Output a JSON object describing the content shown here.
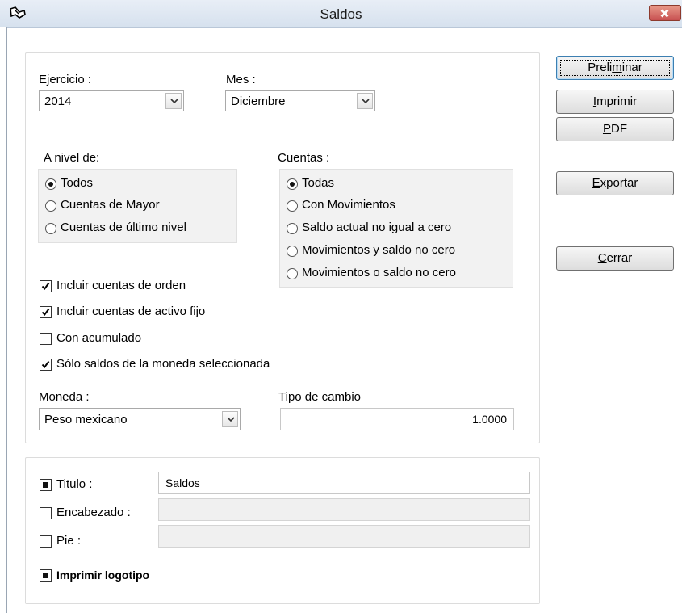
{
  "window": {
    "title": "Saldos"
  },
  "filters": {
    "ejercicio_label": "Ejercicio :",
    "ejercicio_value": "2014",
    "mes_label": "Mes :",
    "mes_value": "Diciembre"
  },
  "nivel": {
    "label": "A nivel de:",
    "options": [
      "Todos",
      "Cuentas de Mayor",
      "Cuentas de último nivel"
    ],
    "selected": 0
  },
  "cuentas": {
    "label": "Cuentas :",
    "options": [
      "Todas",
      "Con Movimientos",
      "Saldo actual no igual a cero",
      "Movimientos y saldo no cero",
      "Movimientos o saldo no cero"
    ],
    "selected": 0
  },
  "checks": {
    "orden": "Incluir cuentas de orden",
    "activo_fijo": "Incluir cuentas de activo fijo",
    "acumulado": "Con acumulado",
    "solo_moneda": "Sólo saldos de la moneda seleccionada"
  },
  "moneda": {
    "label": "Moneda :",
    "value": "Peso mexicano",
    "tipo_label": "Tipo de cambio",
    "tipo_value": "1.0000"
  },
  "report": {
    "titulo_label": "Titulo :",
    "titulo_value": "Saldos",
    "encabezado_label": "Encabezado :",
    "encabezado_value": "",
    "pie_label": "Pie :",
    "pie_value": "",
    "logotipo_label": "Imprimir logotipo"
  },
  "buttons": {
    "preliminar": {
      "pre": "Preli",
      "acc": "m",
      "post": "inar"
    },
    "imprimir": {
      "pre": "",
      "acc": "I",
      "post": "mprimir"
    },
    "pdf": {
      "pre": "",
      "acc": "P",
      "post": "DF"
    },
    "exportar": {
      "pre": "",
      "acc": "E",
      "post": "xportar"
    },
    "cerrar": {
      "pre": "",
      "acc": "C",
      "post": "errar"
    }
  }
}
